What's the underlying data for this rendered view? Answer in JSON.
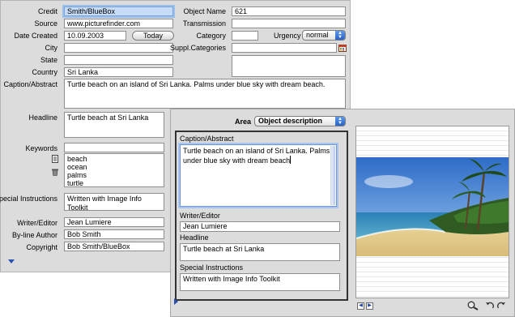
{
  "back_panel": {
    "credit": {
      "label": "Credit",
      "value": "Smith/BlueBox"
    },
    "source": {
      "label": "Source",
      "value": "www.picturefinder.com"
    },
    "date_created": {
      "label": "Date Created",
      "value": "10.09.2003"
    },
    "today_button": "Today",
    "city": {
      "label": "City",
      "value": ""
    },
    "state": {
      "label": "State",
      "value": ""
    },
    "country": {
      "label": "Country",
      "value": "Sri Lanka"
    },
    "object_name": {
      "label": "Object Name",
      "value": "621"
    },
    "transmission": {
      "label": "Transmission",
      "value": ""
    },
    "category": {
      "label": "Category",
      "value": ""
    },
    "urgency": {
      "label": "Urgency",
      "value": "normal"
    },
    "suppl_categories": {
      "label": "Suppl.Categories",
      "value": ""
    },
    "caption_abstract": {
      "label": "Caption/Abstract",
      "value": "Turtle beach on an island of Sri Lanka. Palms under blue sky with dream beach."
    },
    "headline": {
      "label": "Headline",
      "value": "Turtle beach at Sri Lanka"
    },
    "keywords": {
      "label": "Keywords",
      "input": "",
      "items": [
        "beach",
        "ocean",
        "palms",
        "turtle"
      ]
    },
    "special_instructions": {
      "label": "Special Instructions",
      "value": "Written with Image Info Toolkit"
    },
    "writer_editor": {
      "label": "Writer/Editor",
      "value": "Jean Lumiere"
    },
    "byline_author": {
      "label": "By-line Author",
      "value": "Bob Smith"
    },
    "copyright": {
      "label": "Copyright",
      "value": "Bob Smith/BlueBox"
    }
  },
  "front_panel": {
    "area": {
      "label": "Area",
      "value": "Object description"
    },
    "caption_abstract": {
      "label": "Caption/Abstract",
      "value": "Turtle beach on an island of Sri Lanka. Palms under blue sky with dream beach"
    },
    "writer_editor": {
      "label": "Writer/Editor",
      "value": "Jean Lumiere"
    },
    "headline": {
      "label": "Headline",
      "value": "Turtle beach at Sri Lanka"
    },
    "special_instructions": {
      "label": "Special Instructions",
      "value": "Written with Image Info Toolkit"
    }
  },
  "icons": [
    "calendar-icon",
    "keyword-list-icon",
    "trash-icon",
    "disclosure-triangle-icon",
    "prev-arrow-icon",
    "next-arrow-icon",
    "magnifier-icon",
    "rotate-left-icon",
    "rotate-right-icon"
  ],
  "colors": {
    "panel": "#dcdcdc",
    "focus": "#9cc0ee",
    "aqua": "#2a62c8"
  }
}
